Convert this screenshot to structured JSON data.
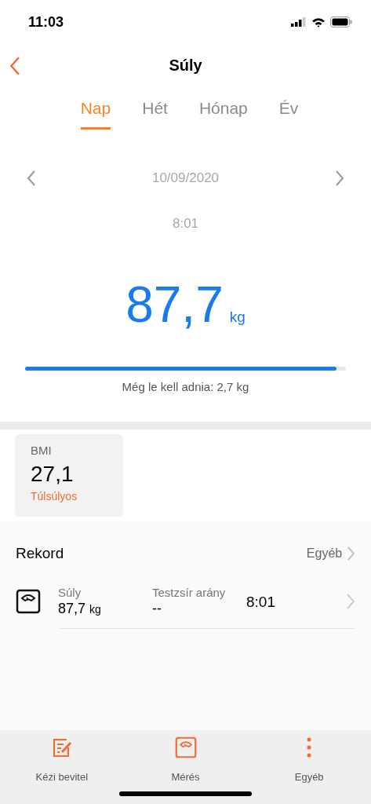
{
  "status_bar": {
    "time": "11:03"
  },
  "header": {
    "title": "Súly"
  },
  "tabs": [
    {
      "label": "Nap",
      "selected": true
    },
    {
      "label": "Hét",
      "selected": false
    },
    {
      "label": "Hónap",
      "selected": false
    },
    {
      "label": "Év",
      "selected": false
    }
  ],
  "date": "10/09/2020",
  "time": "8:01",
  "weight": {
    "value": "87,7",
    "unit": "kg"
  },
  "goal": {
    "level": 0.97,
    "text": "Még le kell adnia: 2,7 kg"
  },
  "bmi": {
    "label": "BMI",
    "value": "27,1",
    "status": "Túlsúlyos"
  },
  "record": {
    "title": "Rekord",
    "more": "Egyéb",
    "rows": [
      {
        "weight_label": "Súly",
        "weight_value": "87,7",
        "weight_unit": "kg",
        "fat_label": "Testzsír arány",
        "fat_value": "--",
        "time": "8:01"
      }
    ]
  },
  "bottom_bar": [
    {
      "kind": "edit",
      "label": "Kézi bevitel"
    },
    {
      "kind": "scale",
      "label": "Mérés"
    },
    {
      "kind": "more",
      "label": "Egyéb"
    }
  ]
}
